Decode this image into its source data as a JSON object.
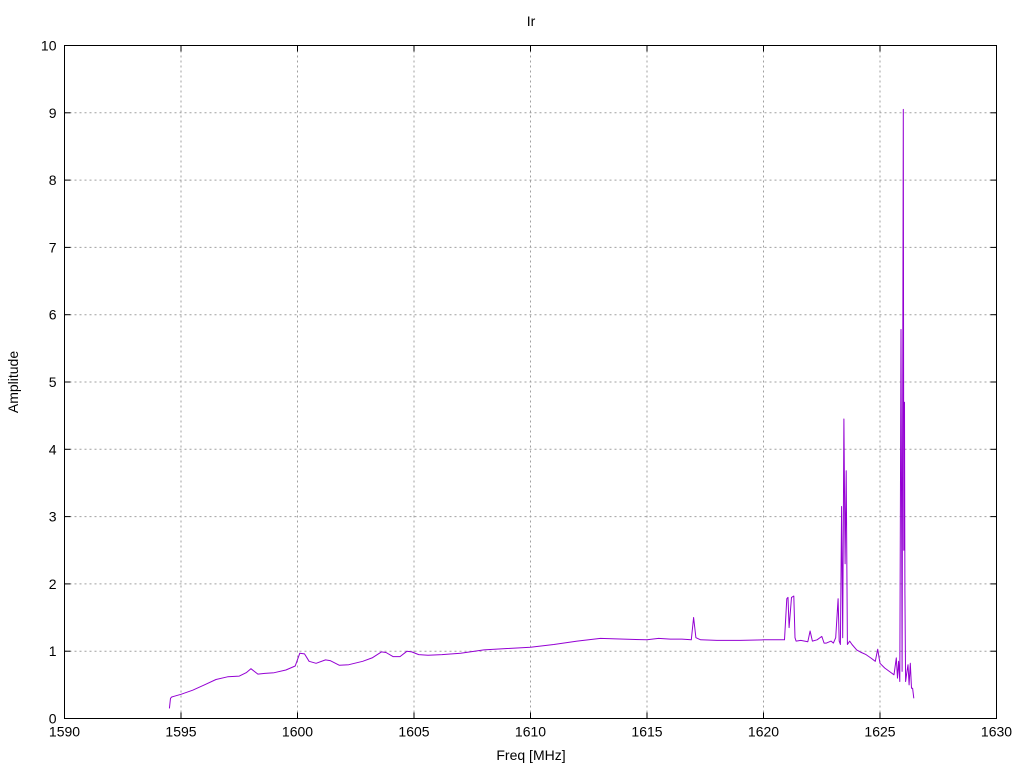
{
  "chart_data": {
    "type": "line",
    "title": "Ir",
    "xlabel": "Freq [MHz]",
    "ylabel": "Amplitude",
    "xlim": [
      1590,
      1630
    ],
    "ylim": [
      0,
      10
    ],
    "xticks": [
      1590,
      1595,
      1600,
      1605,
      1610,
      1615,
      1620,
      1625,
      1630
    ],
    "yticks": [
      0,
      1,
      2,
      3,
      4,
      5,
      6,
      7,
      8,
      9,
      10
    ],
    "grid": true,
    "series": [
      {
        "color": "#9400d3",
        "x": [
          1594.5,
          1594.55,
          1594.6,
          1594.7,
          1595.0,
          1595.5,
          1596.0,
          1596.5,
          1597.0,
          1597.5,
          1597.8,
          1598.0,
          1598.3,
          1598.6,
          1599.0,
          1599.5,
          1599.9,
          1600.1,
          1600.3,
          1600.5,
          1600.8,
          1601.2,
          1601.4,
          1601.8,
          1602.2,
          1602.8,
          1603.2,
          1603.6,
          1603.8,
          1604.1,
          1604.4,
          1604.7,
          1604.9,
          1605.2,
          1605.6,
          1606.2,
          1607.0,
          1608.0,
          1609.0,
          1610.0,
          1611.0,
          1612.0,
          1613.0,
          1614.0,
          1615.0,
          1615.5,
          1616.0,
          1616.5,
          1616.9,
          1617.0,
          1617.1,
          1617.3,
          1618.0,
          1619.0,
          1620.0,
          1620.9,
          1621.0,
          1621.05,
          1621.1,
          1621.2,
          1621.3,
          1621.35,
          1621.4,
          1621.6,
          1621.9,
          1622.0,
          1622.1,
          1622.3,
          1622.5,
          1622.6,
          1622.7,
          1622.9,
          1623.0,
          1623.1,
          1623.2,
          1623.25,
          1623.3,
          1623.35,
          1623.4,
          1623.45,
          1623.5,
          1623.55,
          1623.6,
          1623.7,
          1623.8,
          1624.0,
          1624.2,
          1624.4,
          1624.6,
          1624.8,
          1624.9,
          1625.0,
          1625.2,
          1625.4,
          1625.6,
          1625.7,
          1625.75,
          1625.8,
          1625.85,
          1625.9,
          1625.95,
          1626.0,
          1626.02,
          1626.05,
          1626.07,
          1626.1,
          1626.15,
          1626.2,
          1626.25,
          1626.3,
          1626.35,
          1626.4,
          1626.45
        ],
        "y": [
          0.15,
          0.3,
          0.32,
          0.33,
          0.36,
          0.42,
          0.5,
          0.58,
          0.62,
          0.63,
          0.68,
          0.74,
          0.66,
          0.67,
          0.68,
          0.72,
          0.78,
          0.97,
          0.96,
          0.85,
          0.82,
          0.87,
          0.86,
          0.79,
          0.8,
          0.85,
          0.9,
          0.99,
          0.98,
          0.92,
          0.92,
          1.0,
          0.99,
          0.95,
          0.94,
          0.95,
          0.97,
          1.02,
          1.04,
          1.06,
          1.1,
          1.15,
          1.19,
          1.18,
          1.17,
          1.19,
          1.18,
          1.18,
          1.17,
          1.5,
          1.2,
          1.17,
          1.16,
          1.16,
          1.17,
          1.17,
          1.78,
          1.8,
          1.35,
          1.8,
          1.82,
          1.2,
          1.15,
          1.16,
          1.14,
          1.3,
          1.15,
          1.17,
          1.22,
          1.12,
          1.12,
          1.15,
          1.12,
          1.2,
          1.78,
          1.15,
          1.1,
          3.15,
          1.2,
          4.45,
          2.3,
          3.68,
          1.1,
          1.15,
          1.1,
          1.02,
          0.98,
          0.95,
          0.9,
          0.85,
          1.03,
          0.82,
          0.75,
          0.7,
          0.65,
          0.9,
          0.6,
          0.85,
          0.55,
          5.78,
          0.7,
          9.05,
          2.5,
          4.7,
          1.9,
          0.55,
          0.68,
          0.8,
          0.5,
          0.82,
          0.45,
          0.45,
          0.3
        ]
      }
    ]
  }
}
